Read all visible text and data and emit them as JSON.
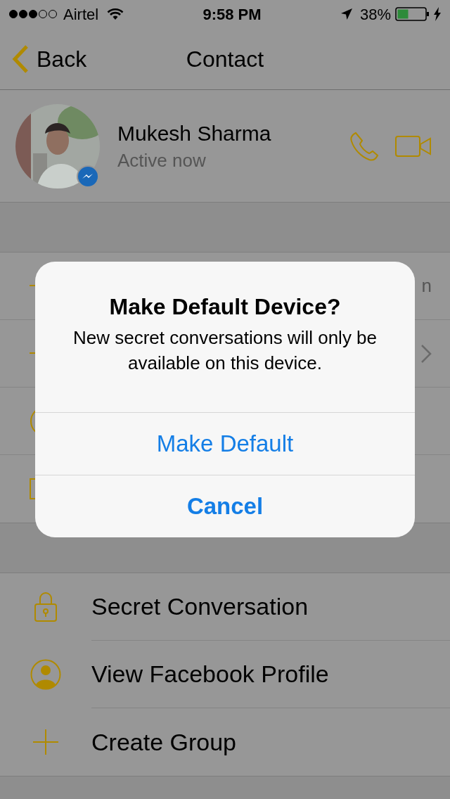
{
  "status_bar": {
    "carrier": "Airtel",
    "time": "9:58 PM",
    "battery": "38%"
  },
  "nav": {
    "back": "Back",
    "title": "Contact"
  },
  "contact": {
    "name": "Mukesh Sharma",
    "status": "Active now"
  },
  "hidden_rows": [
    {
      "kind": "text",
      "text": "n"
    },
    {
      "kind": "chevron"
    },
    {
      "kind": "circle"
    },
    {
      "kind": "square"
    }
  ],
  "actions": [
    {
      "kind": "lock",
      "label": "Secret Conversation"
    },
    {
      "kind": "profile",
      "label": "View Facebook Profile"
    },
    {
      "kind": "plus",
      "label": "Create Group"
    }
  ],
  "dialog": {
    "title": "Make Default Device?",
    "message": "New secret conversations will only be available on this device.",
    "buttons": [
      {
        "label": "Make Default",
        "bold": false
      },
      {
        "label": "Cancel",
        "bold": true
      }
    ]
  }
}
